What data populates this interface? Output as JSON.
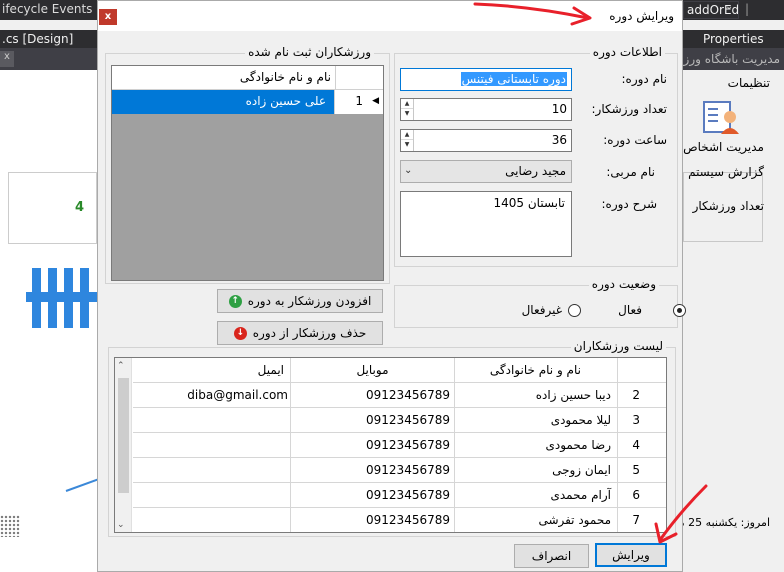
{
  "ide": {
    "top_left_text": "ifecycle Events",
    "tab_left": ".cs [Design]",
    "mini_close": "x",
    "left_number": "4",
    "top_right_dropdown": "addOrEd",
    "top_right_sep": "|",
    "properties_label": "Properties",
    "right_caption": "مدیریت باشگاه ورز",
    "right_menu": "تنظیمات",
    "right_manage_label": "مدیریت اشخاص",
    "right_report_label": "گزارش سیستم",
    "right_count_label": "تعداد ورزشکار",
    "right_date": "امروز: یکشنبه 25 مر"
  },
  "dialog": {
    "title": "ویرایش دوره",
    "close_label": "x",
    "course_info": {
      "legend": "اطلاعات دوره",
      "name_label": "نام دوره:",
      "name_value": "دوره تابستانی فیتنس",
      "count_label": "تعداد ورزشکار:",
      "count_value": "10",
      "hours_label": "ساعت دوره:",
      "hours_value": "36",
      "coach_label": "نام مربی:",
      "coach_value": "مجید رضایی",
      "desc_label": "شرح دوره:",
      "desc_value": "تابستان 1405"
    },
    "registered": {
      "legend": "ورزشکاران ثبت نام شده",
      "column": "نام و نام خانوادگی",
      "rows": [
        {
          "index": "1",
          "name": "علی حسین زاده"
        }
      ],
      "add_button": "افزودن ورزشکار به دوره",
      "remove_button": "حذف ورزشکار از دوره"
    },
    "status": {
      "legend": "وضعیت دوره",
      "active_label": "فعال",
      "inactive_label": "غیرفعال",
      "active_checked": true
    },
    "athletes": {
      "legend": "لیست ورزشکاران",
      "columns": {
        "name": "نام و نام خانوادگی",
        "mobile": "موبایل",
        "email": "ایمیل"
      },
      "rows": [
        {
          "index": "2",
          "name": "دیبا حسین زاده",
          "mobile": "09123456789",
          "email": "diba@gmail.com"
        },
        {
          "index": "3",
          "name": "لیلا محمودی",
          "mobile": "09123456789",
          "email": ""
        },
        {
          "index": "4",
          "name": "رضا محمودی",
          "mobile": "09123456789",
          "email": ""
        },
        {
          "index": "5",
          "name": "ایمان زوجی",
          "mobile": "09123456789",
          "email": ""
        },
        {
          "index": "6",
          "name": "آرام محمدی",
          "mobile": "09123456789",
          "email": ""
        },
        {
          "index": "7",
          "name": "محمود تفرشی",
          "mobile": "09123456789",
          "email": ""
        }
      ]
    },
    "buttons": {
      "edit": "ویرایش",
      "cancel": "انصراف"
    }
  },
  "colors": {
    "accent": "#0078d7",
    "annotation": "#e8202a",
    "add_icon": "#2ea043",
    "remove_icon": "#d9251c"
  }
}
